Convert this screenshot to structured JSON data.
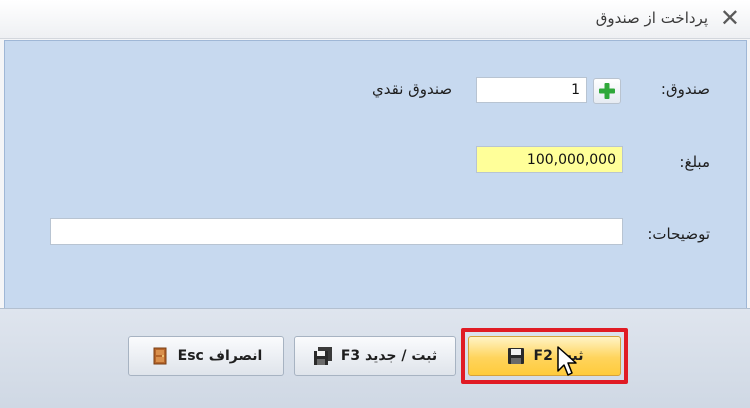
{
  "window": {
    "title": "پرداخت از صندوق",
    "close_icon": "close-icon"
  },
  "form": {
    "fund_label": "صندوق:",
    "fund_code": "1",
    "fund_name": "صندوق نقدي",
    "amount_label": "مبلغ:",
    "amount_value": "100,000,000",
    "description_label": "توضيحات:",
    "description_value": ""
  },
  "buttons": {
    "save_label": "ثبت F2",
    "save_new_label": "ثبت / جدید F3",
    "cancel_label": "انصراف Esc"
  },
  "colors": {
    "panel": "#c7d9ef",
    "amount_bg": "#ffff99",
    "primary_button": "#ffd45c",
    "highlight": "#e01b24"
  }
}
